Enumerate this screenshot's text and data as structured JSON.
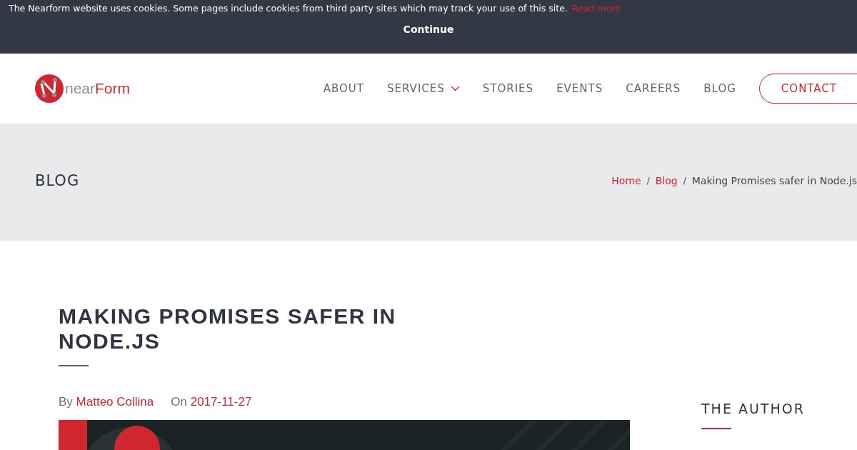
{
  "cookie_banner": {
    "message": "The Nearform website uses cookies. Some pages include cookies from third party sites which may track your use of this site.",
    "link": "Read more",
    "button": "Continue"
  },
  "logo": {
    "prefix": "near",
    "suffix": "Form"
  },
  "nav": [
    {
      "label": "ABOUT",
      "kind": "link",
      "has_menu": false
    },
    {
      "label": "SERVICES",
      "kind": "link",
      "has_menu": true
    },
    {
      "label": "STORIES",
      "kind": "link",
      "has_menu": false
    },
    {
      "label": "EVENTS",
      "kind": "link",
      "has_menu": false
    },
    {
      "label": "CAREERS",
      "kind": "link",
      "has_menu": false
    },
    {
      "label": "BLOG",
      "kind": "link",
      "has_menu": false
    },
    {
      "label": "CONTACT",
      "kind": "button",
      "has_menu": false
    }
  ],
  "page_header": {
    "title": "BLOG",
    "breadcrumbs": [
      {
        "label": "Home",
        "link": true
      },
      {
        "separator": "/",
        "label": "Blog",
        "link": true
      },
      {
        "separator": "/",
        "label": "Making Promises safer in Node.js",
        "link": false
      }
    ]
  },
  "article": {
    "title": "MAKING PROMISES SAFER IN NODE.JS",
    "by_label": "By",
    "author": "Matteo Collina",
    "on_label": "On",
    "date": "2017-11-27"
  },
  "sidebar": {
    "heading": "THE AUTHOR"
  }
}
